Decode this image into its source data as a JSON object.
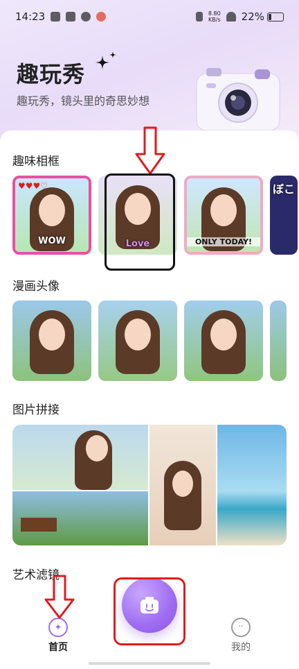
{
  "status_bar": {
    "time": "14:23",
    "net_speed_value": "8.80",
    "net_speed_unit": "KB/s",
    "battery": "22%",
    "battery_level": 0.22
  },
  "header": {
    "app_title": "趣玩秀",
    "subtitle": "趣玩秀，镜头里的奇思妙想"
  },
  "sections": {
    "frames": {
      "title": "趣味相框",
      "items": [
        {
          "overlay": "WOW"
        },
        {
          "overlay": "Love"
        },
        {
          "overlay": "ONLY TODAY!"
        },
        {
          "overlay": "ぼこ"
        }
      ]
    },
    "comic": {
      "title": "漫画头像"
    },
    "collage": {
      "title": "图片拼接"
    },
    "filters": {
      "title": "艺术滤镜"
    }
  },
  "tabbar": {
    "home_label": "首页",
    "mine_label": "我的"
  },
  "colors": {
    "accent": "#9f6cf1",
    "annotation_red": "#e01b1b",
    "annotation_black": "#111111"
  }
}
